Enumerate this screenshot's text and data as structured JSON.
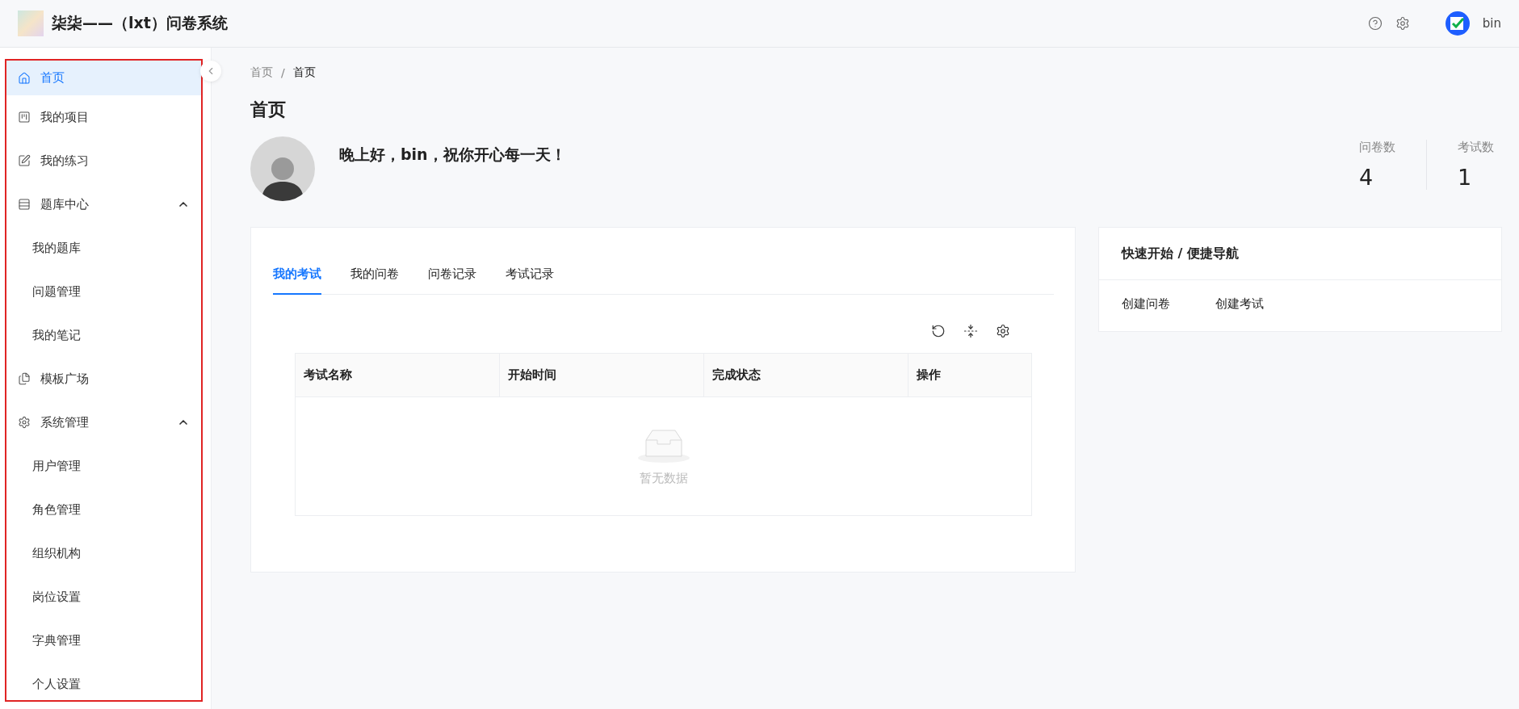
{
  "header": {
    "title": "柒柒——（lxt）问卷系统",
    "user": "bin"
  },
  "sidebar": {
    "items": [
      {
        "label": "首页",
        "selected": true
      },
      {
        "label": "我的项目",
        "selected": false
      },
      {
        "label": "我的练习",
        "selected": false
      },
      {
        "label": "题库中心",
        "selected": false,
        "expanded": true,
        "children": [
          {
            "label": "我的题库",
            "selected": false
          },
          {
            "label": "问题管理",
            "selected": false
          },
          {
            "label": "我的笔记",
            "selected": false
          }
        ]
      },
      {
        "label": "模板广场",
        "selected": false
      },
      {
        "label": "系统管理",
        "selected": false,
        "expanded": true,
        "children": [
          {
            "label": "用户管理",
            "selected": false
          },
          {
            "label": "角色管理",
            "selected": false
          },
          {
            "label": "组织机构",
            "selected": false
          },
          {
            "label": "岗位设置",
            "selected": false
          },
          {
            "label": "字典管理",
            "selected": false
          },
          {
            "label": "个人设置",
            "selected": false
          }
        ]
      }
    ]
  },
  "breadcrumb": {
    "items": [
      "首页",
      "首页"
    ],
    "separator": "/"
  },
  "page_title": "首页",
  "greeting": "晚上好，bin，祝你开心每一天！",
  "stats": [
    {
      "label": "问卷数",
      "value": "4"
    },
    {
      "label": "考试数",
      "value": "1"
    }
  ],
  "tabs": [
    {
      "label": "我的考试",
      "selected": true
    },
    {
      "label": "我的问卷",
      "selected": false
    },
    {
      "label": "问卷记录",
      "selected": false
    },
    {
      "label": "考试记录",
      "selected": false
    }
  ],
  "table": {
    "columns": [
      "考试名称",
      "开始时间",
      "完成状态",
      "操作"
    ],
    "empty_text": "暂无数据"
  },
  "quick_nav": {
    "title": "快速开始 / 便捷导航",
    "links": [
      "创建问卷",
      "创建考试"
    ]
  }
}
